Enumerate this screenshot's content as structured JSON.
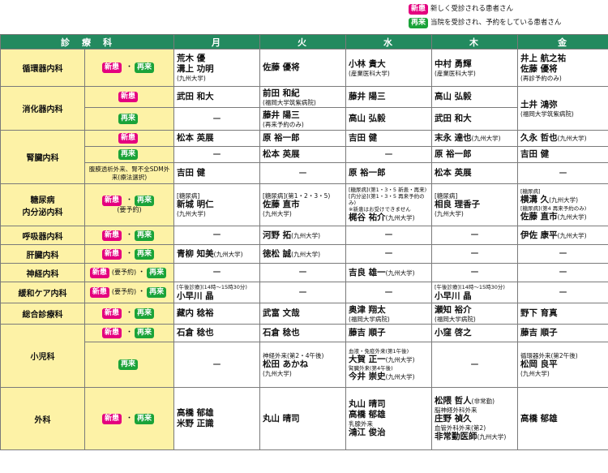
{
  "legend": {
    "new_tag": "新患",
    "new_text": "新しく受診される患者さん",
    "re_tag": "再来",
    "re_text": "当院を受診され、予約をしている患者さん"
  },
  "header": {
    "dept": "診　療　科",
    "mon": "月",
    "tue": "火",
    "wed": "水",
    "thu": "木",
    "fri": "金"
  },
  "tags": {
    "new": "新患",
    "re": "再来",
    "dot": "・"
  },
  "rows": {
    "cardio": {
      "dept": "循環器内科",
      "mon": [
        "荒木 優",
        "溝上 功明"
      ],
      "mon_sub": "(九州大学)",
      "tue": "佐藤 優将",
      "wed": "小林 貴大",
      "wed_sub": "(産業医科大学)",
      "thu": "中村 勇輝",
      "thu_sub": "(産業医科大学)",
      "fri": [
        "井上 航之祐",
        "佐藤 優将"
      ],
      "fri_sub": "(再診予約のみ)"
    },
    "gastro": {
      "dept": "消化器内科",
      "new": {
        "mon": "武田 和大",
        "tue": "前田 和紀",
        "tue_sub": "(福岡大学筑紫病院)",
        "wed": "藤井 陽三",
        "thu": "高山 弘毅"
      },
      "re": {
        "mon": "ー",
        "tue": "藤井 陽三",
        "tue_sub": "(再来予約のみ)",
        "wed": "高山 弘毅",
        "thu": "武田 和大"
      },
      "fri": "土井 鴻弥",
      "fri_sub": "(福岡大学筑紫病院)"
    },
    "renal": {
      "dept": "腎臓内科",
      "new": {
        "mon": "松本 英展",
        "tue": "原 裕一郎",
        "wed": "吉田 健",
        "thu": "末永 達也",
        "thu_sub": "(九州大学)",
        "fri": "久永 哲也",
        "fri_sub": "(九州大学)"
      },
      "re": {
        "mon": "ー",
        "tue": "松本 英展",
        "wed": "ー",
        "thu": "原 裕一郎",
        "fri": "吉田 健"
      },
      "dialysis_type": "腹膜透析外来、腎不全SDM外来(療法選択)",
      "dialysis": {
        "mon": "吉田 健",
        "tue": "ー",
        "wed": "原 裕一郎",
        "thu": "松本 英展",
        "fri": "ー"
      }
    },
    "diabetes": {
      "dept": "糖尿病内分泌内科",
      "dept_line1": "糖尿病",
      "dept_line2": "内分泌内科",
      "note": "(要予約)",
      "mon_pre": "[糖尿病]",
      "mon": "新城 明仁",
      "mon_sub": "(九州大学)",
      "tue_pre": "[糖尿病](第1・2・3・5)",
      "tue": "佐藤 直市",
      "tue_sub": "(九州大学)",
      "wed_pre1": "[糖尿病](第1・3・5 新患・再来)",
      "wed_pre2": "[内分泌](第1・3・5 再来予約のみ)",
      "wed_pre3": "※新患はお受けできません",
      "wed": "梶谷 祐介",
      "wed_sub": "(九州大学)",
      "thu_pre": "[糖尿病]",
      "thu": "相良 理香子",
      "thu_sub": "(九州大学)",
      "fri_pre1": "[糖尿病]",
      "fri1": "横溝 久",
      "fri1_sub": "(九州大学)",
      "fri_pre2": "[糖尿病](第4 再来予約のみ)",
      "fri2": "佐藤 直市",
      "fri2_sub": "(九州大学)"
    },
    "resp": {
      "dept": "呼吸器内科",
      "mon": "ー",
      "tue": "河野 拓",
      "tue_sub": "(九州大学)",
      "wed": "ー",
      "thu": "ー",
      "fri": "伊佐 康平",
      "fri_sub": "(九州大学)"
    },
    "liver": {
      "dept": "肝臓内科",
      "mon": "青柳 知美",
      "mon_sub": "(九州大学)",
      "tue": "徳松 誠",
      "tue_sub": "(九州大学)",
      "wed": "ー",
      "thu": "ー",
      "fri": "ー"
    },
    "neuro": {
      "dept": "神経内科",
      "note": "(要予約)",
      "mon": "ー",
      "tue": "ー",
      "wed": "吉良 雄一",
      "wed_sub": "(九州大学)",
      "thu": "ー",
      "fri": "ー"
    },
    "palliative": {
      "dept": "緩和ケア内科",
      "note": "(要予約)",
      "mon_pre": "[午後診療](14時～15時30分)",
      "mon": "小早川 晶",
      "tue": "ー",
      "wed": "ー",
      "thu_pre": "[午後診療](14時～15時30分)",
      "thu": "小早川 晶",
      "fri": "ー"
    },
    "general": {
      "dept": "総合診療科",
      "mon": "藏内 稔裕",
      "tue": "武富 文哉",
      "wed": "奥津 翔太",
      "wed_sub": "(福岡大学病院)",
      "thu": "瀬知 裕介",
      "thu_sub": "(福岡大学病院)",
      "fri": "野下 育真"
    },
    "pediatrics": {
      "dept": "小児科",
      "new": {
        "mon": "石倉 稔也",
        "tue": "石倉 稔也",
        "wed": "藤吉 順子",
        "thu": "小窪 啓之",
        "fri": "藤吉 順子"
      },
      "re": {
        "mon": "ー",
        "tue_pre": "神経外来(第2・4午後)",
        "tue": "松田 あかね",
        "tue_sub": "(九州大学)",
        "wed_pre1": "血液・免疫外来(第1午後)",
        "wed1": "大賀 正一",
        "wed1_sub": "(九州大学)",
        "wed_pre2": "腎臓外来(第4午後)",
        "wed2": "今井 崇史",
        "wed2_sub": "(九州大学)",
        "thu": "ー",
        "fri_pre": "循環器外来(第2午後)",
        "fri": "松岡 良平",
        "fri_sub": "(九州大学)"
      }
    },
    "surgery": {
      "dept": "外科",
      "mon": [
        "高橋 郁雄",
        "米野 正識"
      ],
      "tue": "丸山 晴司",
      "wed": [
        "丸山 晴司",
        "高橋 郁雄"
      ],
      "wed_pre": "乳腺外来",
      "wed3": "鴻江 俊治",
      "thu1": "松隈 哲人",
      "thu1_note": "(非常勤)",
      "thu_pre2": "脳神経外科外来",
      "thu2": "庄野 禎久",
      "thu_pre3": "血管外科外来(第2)",
      "thu3": "非常勤医師",
      "thu3_sub": "(九州大学)",
      "fri": "高橋 郁雄"
    }
  }
}
